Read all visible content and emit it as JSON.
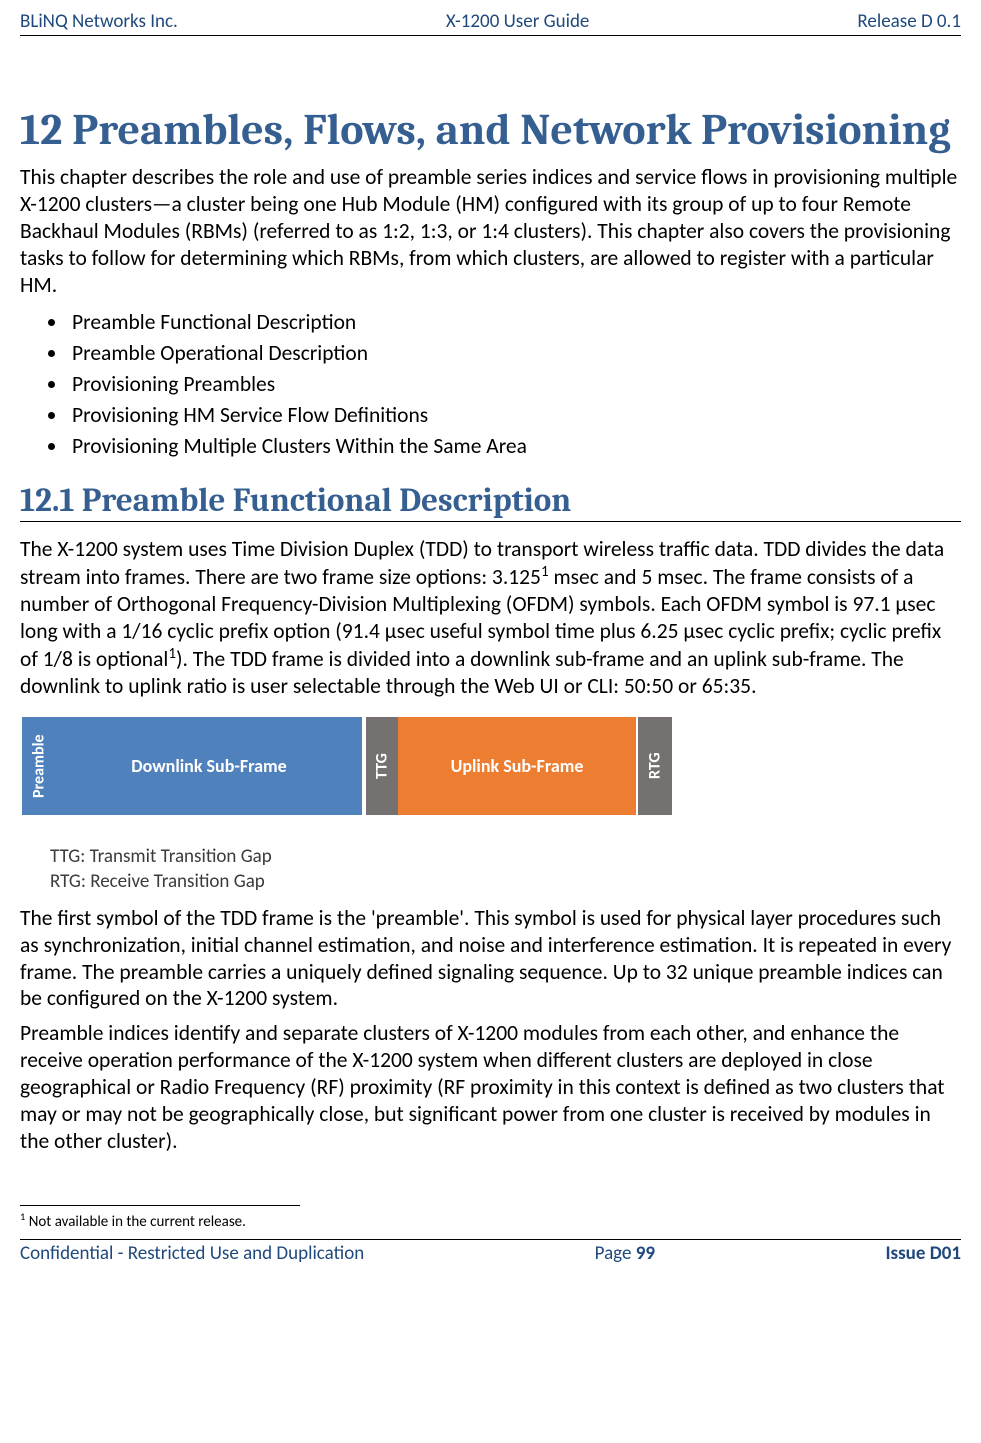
{
  "header": {
    "left": "BLiNQ Networks Inc.",
    "center": "X-1200 User Guide",
    "right": "Release D 0.1"
  },
  "chapter": {
    "title": "12 Preambles, Flows, and Network Provisioning",
    "intro": "This chapter describes the role and use of preamble series indices and service flows in provisioning multiple X-1200 clusters—a cluster being one Hub Module (HM) configured with its group of up to four Remote Backhaul Modules (RBMs) (referred to as 1:2, 1:3, or 1:4 clusters). This chapter also covers the provisioning tasks to follow for determining which RBMs, from which clusters, are allowed to register with a particular HM.",
    "bullets": [
      "Preamble Functional Description",
      "Preamble Operational Description",
      "Provisioning Preambles",
      "Provisioning HM Service Flow Definitions",
      "Provisioning Multiple Clusters Within the Same Area"
    ]
  },
  "section": {
    "title": "12.1 Preamble Functional Description",
    "p1_a": "The X-1200 system uses Time Division Duplex (TDD) to transport wireless traffic data. TDD divides the data stream into frames. There are two frame size options: 3.125",
    "p1_sup1": "1",
    "p1_b": " msec and 5 msec. The frame consists of a number of Orthogonal Frequency-Division Multiplexing (OFDM) symbols. Each OFDM symbol is 97.1 μsec long with a 1/16 cyclic prefix option (91.4 μsec useful symbol time plus 6.25 μsec cyclic prefix; cyclic prefix of 1/8 is optional",
    "p1_sup2": "1",
    "p1_c": "). The TDD frame is divided into a downlink sub-frame and an uplink sub-frame. The downlink to uplink ratio is user selectable through the Web UI or CLI: 50:50 or 65:35.",
    "p2": "The first symbol of the TDD frame is the 'preamble'. This symbol is used for physical layer procedures such as synchronization, initial channel estimation, and noise and interference estimation. It is repeated in every frame. The preamble carries a uniquely defined signaling sequence. Up to 32 unique preamble indices can be configured on the X-1200 system.",
    "p3": "Preamble indices identify and separate clusters of X-1200 modules from each other, and enhance the receive operation performance of the X-1200 system when different clusters are deployed in close geographical or Radio Frequency (RF) proximity (RF proximity in this context is defined as two clusters that may or may not be geographically close, but significant power from one cluster is received by modules in the other cluster)."
  },
  "diagram": {
    "preamble": "Preamble",
    "downlink": "Downlink Sub-Frame",
    "ttg": "TTG",
    "uplink": "Uplink Sub-Frame",
    "rtg": "RTG",
    "legend1": "TTG: Transmit Transition Gap",
    "legend2": "RTG: Receive Transition Gap"
  },
  "footnote": {
    "marker": "1",
    "text": " Not available in the current release."
  },
  "footer": {
    "left": "Confidential - Restricted Use and Duplication",
    "center_prefix": "Page ",
    "center_num": "99",
    "right": "Issue D01"
  }
}
